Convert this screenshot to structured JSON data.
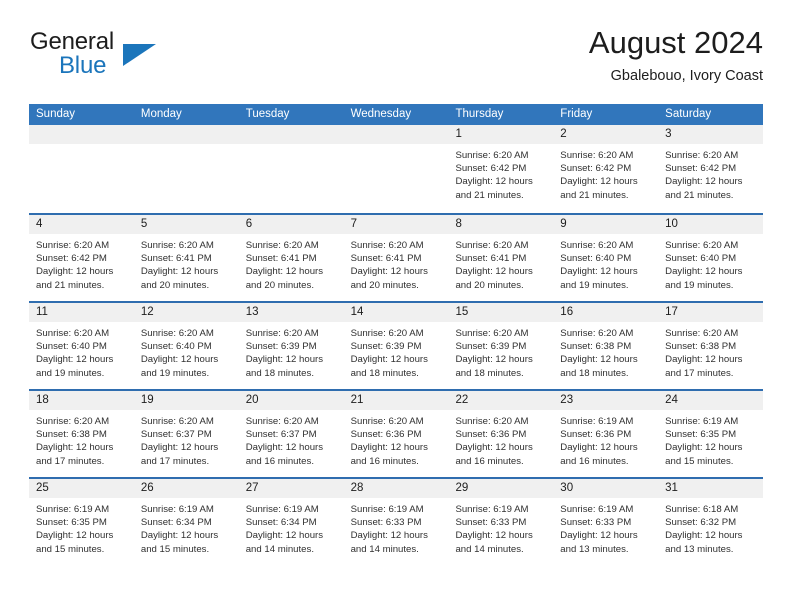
{
  "brand": {
    "name_line1": "General",
    "name_line2": "Blue",
    "accent_color": "#1b75bb"
  },
  "header": {
    "title": "August 2024",
    "subtitle": "Gbalebouo, Ivory Coast"
  },
  "theme": {
    "header_bg": "#3176bc",
    "row_divider": "#2f6daf",
    "day_band_bg": "#f0f0f0"
  },
  "weekdays": [
    "Sunday",
    "Monday",
    "Tuesday",
    "Wednesday",
    "Thursday",
    "Friday",
    "Saturday"
  ],
  "labels": {
    "sunrise_prefix": "Sunrise:",
    "sunset_prefix": "Sunset:",
    "daylight_prefix": "Daylight:"
  },
  "weeks": [
    [
      {
        "day": "",
        "sunrise": "",
        "sunset": "",
        "daylight_l1": "",
        "daylight_l2": "",
        "empty": true
      },
      {
        "day": "",
        "sunrise": "",
        "sunset": "",
        "daylight_l1": "",
        "daylight_l2": "",
        "empty": true
      },
      {
        "day": "",
        "sunrise": "",
        "sunset": "",
        "daylight_l1": "",
        "daylight_l2": "",
        "empty": true
      },
      {
        "day": "",
        "sunrise": "",
        "sunset": "",
        "daylight_l1": "",
        "daylight_l2": "",
        "empty": true
      },
      {
        "day": "1",
        "sunrise": "Sunrise: 6:20 AM",
        "sunset": "Sunset: 6:42 PM",
        "daylight_l1": "Daylight: 12 hours",
        "daylight_l2": "and 21 minutes.",
        "empty": false
      },
      {
        "day": "2",
        "sunrise": "Sunrise: 6:20 AM",
        "sunset": "Sunset: 6:42 PM",
        "daylight_l1": "Daylight: 12 hours",
        "daylight_l2": "and 21 minutes.",
        "empty": false
      },
      {
        "day": "3",
        "sunrise": "Sunrise: 6:20 AM",
        "sunset": "Sunset: 6:42 PM",
        "daylight_l1": "Daylight: 12 hours",
        "daylight_l2": "and 21 minutes.",
        "empty": false
      }
    ],
    [
      {
        "day": "4",
        "sunrise": "Sunrise: 6:20 AM",
        "sunset": "Sunset: 6:42 PM",
        "daylight_l1": "Daylight: 12 hours",
        "daylight_l2": "and 21 minutes.",
        "empty": false
      },
      {
        "day": "5",
        "sunrise": "Sunrise: 6:20 AM",
        "sunset": "Sunset: 6:41 PM",
        "daylight_l1": "Daylight: 12 hours",
        "daylight_l2": "and 20 minutes.",
        "empty": false
      },
      {
        "day": "6",
        "sunrise": "Sunrise: 6:20 AM",
        "sunset": "Sunset: 6:41 PM",
        "daylight_l1": "Daylight: 12 hours",
        "daylight_l2": "and 20 minutes.",
        "empty": false
      },
      {
        "day": "7",
        "sunrise": "Sunrise: 6:20 AM",
        "sunset": "Sunset: 6:41 PM",
        "daylight_l1": "Daylight: 12 hours",
        "daylight_l2": "and 20 minutes.",
        "empty": false
      },
      {
        "day": "8",
        "sunrise": "Sunrise: 6:20 AM",
        "sunset": "Sunset: 6:41 PM",
        "daylight_l1": "Daylight: 12 hours",
        "daylight_l2": "and 20 minutes.",
        "empty": false
      },
      {
        "day": "9",
        "sunrise": "Sunrise: 6:20 AM",
        "sunset": "Sunset: 6:40 PM",
        "daylight_l1": "Daylight: 12 hours",
        "daylight_l2": "and 19 minutes.",
        "empty": false
      },
      {
        "day": "10",
        "sunrise": "Sunrise: 6:20 AM",
        "sunset": "Sunset: 6:40 PM",
        "daylight_l1": "Daylight: 12 hours",
        "daylight_l2": "and 19 minutes.",
        "empty": false
      }
    ],
    [
      {
        "day": "11",
        "sunrise": "Sunrise: 6:20 AM",
        "sunset": "Sunset: 6:40 PM",
        "daylight_l1": "Daylight: 12 hours",
        "daylight_l2": "and 19 minutes.",
        "empty": false
      },
      {
        "day": "12",
        "sunrise": "Sunrise: 6:20 AM",
        "sunset": "Sunset: 6:40 PM",
        "daylight_l1": "Daylight: 12 hours",
        "daylight_l2": "and 19 minutes.",
        "empty": false
      },
      {
        "day": "13",
        "sunrise": "Sunrise: 6:20 AM",
        "sunset": "Sunset: 6:39 PM",
        "daylight_l1": "Daylight: 12 hours",
        "daylight_l2": "and 18 minutes.",
        "empty": false
      },
      {
        "day": "14",
        "sunrise": "Sunrise: 6:20 AM",
        "sunset": "Sunset: 6:39 PM",
        "daylight_l1": "Daylight: 12 hours",
        "daylight_l2": "and 18 minutes.",
        "empty": false
      },
      {
        "day": "15",
        "sunrise": "Sunrise: 6:20 AM",
        "sunset": "Sunset: 6:39 PM",
        "daylight_l1": "Daylight: 12 hours",
        "daylight_l2": "and 18 minutes.",
        "empty": false
      },
      {
        "day": "16",
        "sunrise": "Sunrise: 6:20 AM",
        "sunset": "Sunset: 6:38 PM",
        "daylight_l1": "Daylight: 12 hours",
        "daylight_l2": "and 18 minutes.",
        "empty": false
      },
      {
        "day": "17",
        "sunrise": "Sunrise: 6:20 AM",
        "sunset": "Sunset: 6:38 PM",
        "daylight_l1": "Daylight: 12 hours",
        "daylight_l2": "and 17 minutes.",
        "empty": false
      }
    ],
    [
      {
        "day": "18",
        "sunrise": "Sunrise: 6:20 AM",
        "sunset": "Sunset: 6:38 PM",
        "daylight_l1": "Daylight: 12 hours",
        "daylight_l2": "and 17 minutes.",
        "empty": false
      },
      {
        "day": "19",
        "sunrise": "Sunrise: 6:20 AM",
        "sunset": "Sunset: 6:37 PM",
        "daylight_l1": "Daylight: 12 hours",
        "daylight_l2": "and 17 minutes.",
        "empty": false
      },
      {
        "day": "20",
        "sunrise": "Sunrise: 6:20 AM",
        "sunset": "Sunset: 6:37 PM",
        "daylight_l1": "Daylight: 12 hours",
        "daylight_l2": "and 16 minutes.",
        "empty": false
      },
      {
        "day": "21",
        "sunrise": "Sunrise: 6:20 AM",
        "sunset": "Sunset: 6:36 PM",
        "daylight_l1": "Daylight: 12 hours",
        "daylight_l2": "and 16 minutes.",
        "empty": false
      },
      {
        "day": "22",
        "sunrise": "Sunrise: 6:20 AM",
        "sunset": "Sunset: 6:36 PM",
        "daylight_l1": "Daylight: 12 hours",
        "daylight_l2": "and 16 minutes.",
        "empty": false
      },
      {
        "day": "23",
        "sunrise": "Sunrise: 6:19 AM",
        "sunset": "Sunset: 6:36 PM",
        "daylight_l1": "Daylight: 12 hours",
        "daylight_l2": "and 16 minutes.",
        "empty": false
      },
      {
        "day": "24",
        "sunrise": "Sunrise: 6:19 AM",
        "sunset": "Sunset: 6:35 PM",
        "daylight_l1": "Daylight: 12 hours",
        "daylight_l2": "and 15 minutes.",
        "empty": false
      }
    ],
    [
      {
        "day": "25",
        "sunrise": "Sunrise: 6:19 AM",
        "sunset": "Sunset: 6:35 PM",
        "daylight_l1": "Daylight: 12 hours",
        "daylight_l2": "and 15 minutes.",
        "empty": false
      },
      {
        "day": "26",
        "sunrise": "Sunrise: 6:19 AM",
        "sunset": "Sunset: 6:34 PM",
        "daylight_l1": "Daylight: 12 hours",
        "daylight_l2": "and 15 minutes.",
        "empty": false
      },
      {
        "day": "27",
        "sunrise": "Sunrise: 6:19 AM",
        "sunset": "Sunset: 6:34 PM",
        "daylight_l1": "Daylight: 12 hours",
        "daylight_l2": "and 14 minutes.",
        "empty": false
      },
      {
        "day": "28",
        "sunrise": "Sunrise: 6:19 AM",
        "sunset": "Sunset: 6:33 PM",
        "daylight_l1": "Daylight: 12 hours",
        "daylight_l2": "and 14 minutes.",
        "empty": false
      },
      {
        "day": "29",
        "sunrise": "Sunrise: 6:19 AM",
        "sunset": "Sunset: 6:33 PM",
        "daylight_l1": "Daylight: 12 hours",
        "daylight_l2": "and 14 minutes.",
        "empty": false
      },
      {
        "day": "30",
        "sunrise": "Sunrise: 6:19 AM",
        "sunset": "Sunset: 6:33 PM",
        "daylight_l1": "Daylight: 12 hours",
        "daylight_l2": "and 13 minutes.",
        "empty": false
      },
      {
        "day": "31",
        "sunrise": "Sunrise: 6:18 AM",
        "sunset": "Sunset: 6:32 PM",
        "daylight_l1": "Daylight: 12 hours",
        "daylight_l2": "and 13 minutes.",
        "empty": false
      }
    ]
  ]
}
